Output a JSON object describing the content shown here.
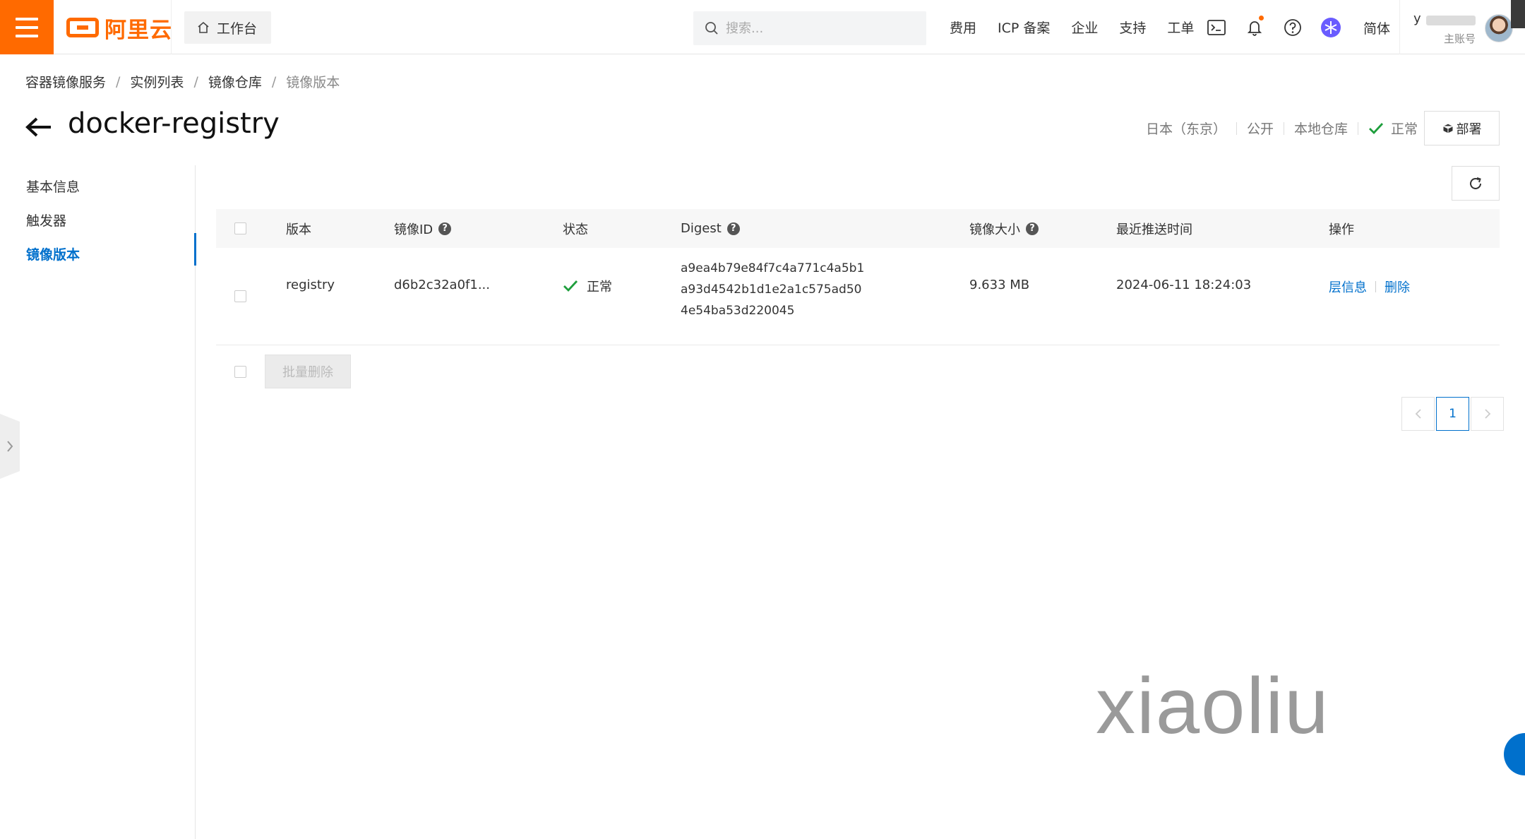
{
  "topbar": {
    "brand": "阿里云",
    "workbench": "工作台",
    "search_placeholder": "搜索...",
    "links": [
      "费用",
      "ICP 备案",
      "企业",
      "支持",
      "工单"
    ],
    "language": "简体",
    "account_name": "y",
    "account_role": "主账号",
    "accent_color": "#ff6a00"
  },
  "breadcrumb": [
    "容器镜像服务",
    "实例列表",
    "镜像仓库",
    "镜像版本"
  ],
  "page": {
    "title": "docker-registry",
    "meta": {
      "region": "日本（东京）",
      "visibility": "公开",
      "repo_type": "本地仓库",
      "status": "正常"
    },
    "deploy_label": "部署"
  },
  "sidenav": {
    "items": [
      "基本信息",
      "触发器",
      "镜像版本"
    ],
    "active_index": 2,
    "active_color": "#0070cc"
  },
  "table": {
    "headers": {
      "version": "版本",
      "image_id": "镜像ID",
      "status": "状态",
      "digest": "Digest",
      "size": "镜像大小",
      "pushed_at": "最近推送时间",
      "actions": "操作"
    },
    "rows": [
      {
        "version": "registry",
        "image_id": "d6b2c32a0f1...",
        "status": "正常",
        "digest_lines": [
          "a9ea4b79e84f7c4a771c4a5b1",
          "a93d4542b1d1e2a1c575ad50",
          "4e54ba53d220045"
        ],
        "size": "9.633 MB",
        "pushed_at": "2024-06-11 18:24:03",
        "actions": [
          "层信息",
          "删除"
        ]
      }
    ]
  },
  "batch_delete_label": "批量删除",
  "pagination": {
    "current_page": "1"
  },
  "watermark": "xiaoliu"
}
